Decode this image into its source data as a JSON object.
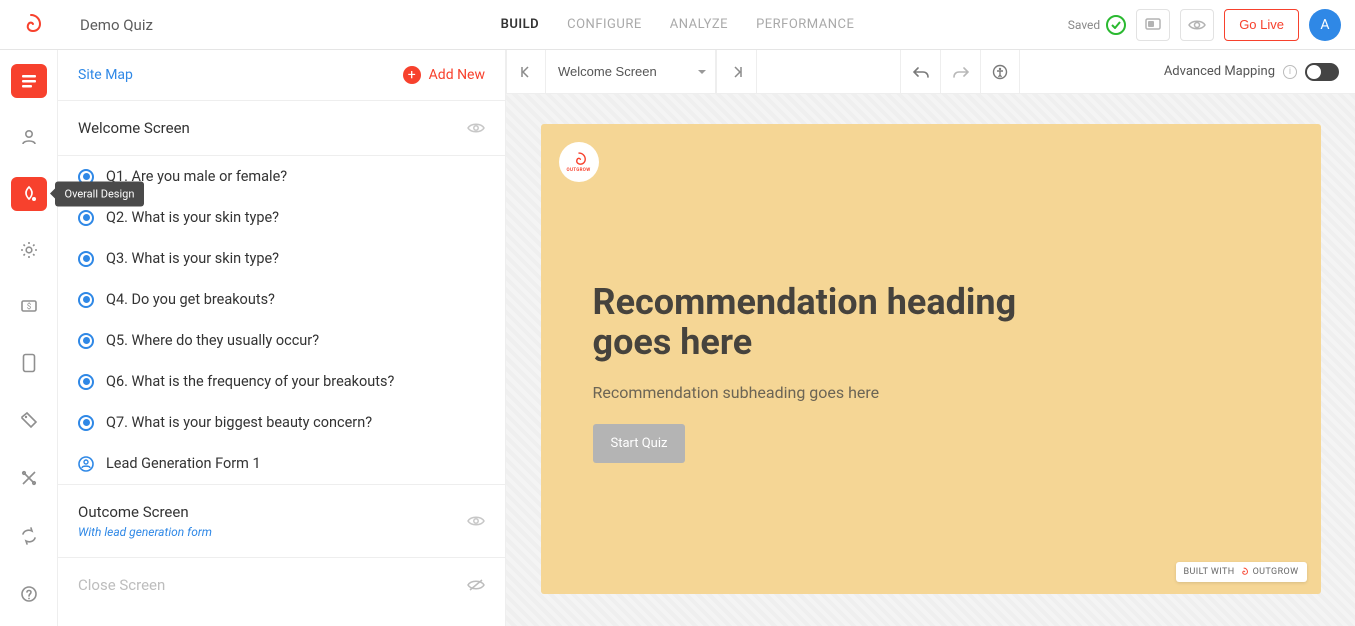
{
  "header": {
    "project_title": "Demo Quiz",
    "tabs": [
      {
        "label": "BUILD",
        "active": true
      },
      {
        "label": "CONFIGURE",
        "active": false
      },
      {
        "label": "ANALYZE",
        "active": false
      },
      {
        "label": "PERFORMANCE",
        "active": false
      }
    ],
    "saved_label": "Saved",
    "go_live_label": "Go Live",
    "avatar_initial": "A"
  },
  "left_rail": {
    "tooltip_overall_design": "Overall Design"
  },
  "sidebar": {
    "sitemap_label": "Site Map",
    "add_new_label": "Add New",
    "welcome_label": "Welcome Screen",
    "questions": [
      {
        "label": "Q1. Are you male or female?"
      },
      {
        "label": "Q2. What is your skin type?"
      },
      {
        "label": "Q3. What is your skin type?"
      },
      {
        "label": "Q4. Do you get breakouts?"
      },
      {
        "label": "Q5. Where do they usually occur?"
      },
      {
        "label": "Q6. What is the frequency of your breakouts?"
      },
      {
        "label": "Q7. What is your biggest beauty concern?"
      }
    ],
    "lead_form_label": "Lead Generation Form 1",
    "outcome_title": "Outcome Screen",
    "outcome_sub": "With lead generation form",
    "close_label": "Close Screen"
  },
  "canvas_toolbar": {
    "screen_select": "Welcome Screen",
    "advanced_mapping_label": "Advanced Mapping"
  },
  "preview": {
    "logo_text": "OUTGROW",
    "heading": "Recommendation heading goes here",
    "subheading": "Recommendation subheading goes here",
    "start_button": "Start Quiz",
    "badge_prefix": "BUILT WITH",
    "badge_brand": "OUTGROW"
  }
}
